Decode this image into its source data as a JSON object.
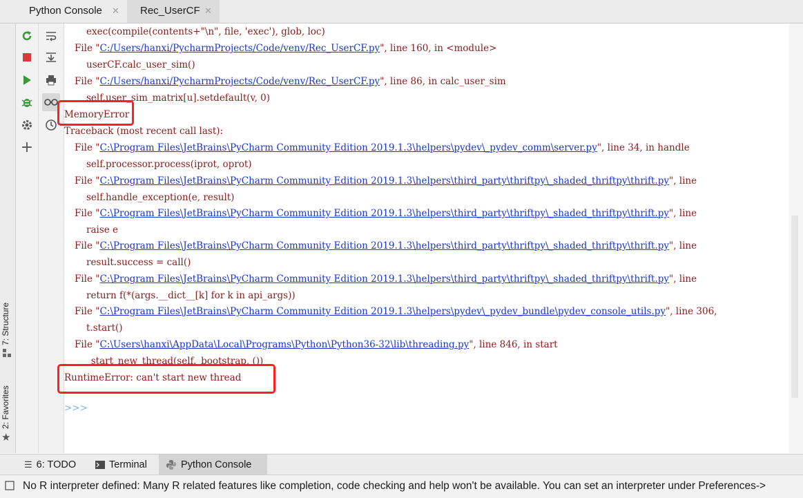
{
  "tabs": [
    {
      "label": "Python Console",
      "active": false
    },
    {
      "label": "Rec_UserCF",
      "active": true
    }
  ],
  "left_strip": {
    "structure_label": "7: Structure",
    "favorites_label": "2: Favorites"
  },
  "toolbar": {
    "icons": [
      "rerun-icon",
      "stop-icon",
      "run-icon",
      "debug-icon",
      "settings-icon",
      "add-icon"
    ],
    "icons2": [
      "soft-wrap-icon",
      "scroll-to-end-icon",
      "print-icon",
      "show-variables-icon",
      "history-icon"
    ]
  },
  "console": {
    "lines": [
      {
        "indent": 2,
        "parts": [
          {
            "t": "exec(compile(contents+\"\\n\", file, 'exec'), glob, loc)",
            "c": "err"
          }
        ]
      },
      {
        "indent": 1,
        "parts": [
          {
            "t": "File \"",
            "c": "err"
          },
          {
            "t": "C:/Users/hanxi/PycharmProjects/Code/venv/Rec_UserCF.py",
            "c": "link"
          },
          {
            "t": "\", line 160, in <module>",
            "c": "err"
          }
        ]
      },
      {
        "indent": 2,
        "parts": [
          {
            "t": "userCF.calc_user_sim()",
            "c": "err"
          }
        ]
      },
      {
        "indent": 1,
        "parts": [
          {
            "t": "File \"",
            "c": "err"
          },
          {
            "t": "C:/Users/hanxi/PycharmProjects/Code/venv/Rec_UserCF.py",
            "c": "link"
          },
          {
            "t": "\", line 86, in calc_user_sim",
            "c": "err"
          }
        ]
      },
      {
        "indent": 2,
        "parts": [
          {
            "t": "self.user_sim_matrix[u].setdefault(v, 0)",
            "c": "err"
          }
        ]
      },
      {
        "indent": 0,
        "parts": [
          {
            "t": "MemoryError",
            "c": "err"
          }
        ]
      },
      {
        "indent": 0,
        "parts": [
          {
            "t": "Traceback (most recent call last):",
            "c": "err"
          }
        ]
      },
      {
        "indent": 1,
        "parts": [
          {
            "t": "File \"",
            "c": "err"
          },
          {
            "t": "C:\\Program Files\\JetBrains\\PyCharm Community Edition 2019.1.3\\helpers\\pydev\\_pydev_comm\\server.py",
            "c": "link"
          },
          {
            "t": "\", line 34, in handle",
            "c": "err"
          }
        ]
      },
      {
        "indent": 2,
        "parts": [
          {
            "t": "self.processor.process(iprot, oprot)",
            "c": "err"
          }
        ]
      },
      {
        "indent": 1,
        "parts": [
          {
            "t": "File \"",
            "c": "err"
          },
          {
            "t": "C:\\Program Files\\JetBrains\\PyCharm Community Edition 2019.1.3\\helpers\\third_party\\thriftpy\\_shaded_thriftpy\\thrift.py",
            "c": "link"
          },
          {
            "t": "\", line",
            "c": "err"
          }
        ]
      },
      {
        "indent": 2,
        "parts": [
          {
            "t": "self.handle_exception(e, result)",
            "c": "err"
          }
        ]
      },
      {
        "indent": 1,
        "parts": [
          {
            "t": "File \"",
            "c": "err"
          },
          {
            "t": "C:\\Program Files\\JetBrains\\PyCharm Community Edition 2019.1.3\\helpers\\third_party\\thriftpy\\_shaded_thriftpy\\thrift.py",
            "c": "link"
          },
          {
            "t": "\", line",
            "c": "err"
          }
        ]
      },
      {
        "indent": 2,
        "parts": [
          {
            "t": "raise e",
            "c": "err"
          }
        ]
      },
      {
        "indent": 1,
        "parts": [
          {
            "t": "File \"",
            "c": "err"
          },
          {
            "t": "C:\\Program Files\\JetBrains\\PyCharm Community Edition 2019.1.3\\helpers\\third_party\\thriftpy\\_shaded_thriftpy\\thrift.py",
            "c": "link"
          },
          {
            "t": "\", line",
            "c": "err"
          }
        ]
      },
      {
        "indent": 2,
        "parts": [
          {
            "t": "result.success = call()",
            "c": "err"
          }
        ]
      },
      {
        "indent": 1,
        "parts": [
          {
            "t": "File \"",
            "c": "err"
          },
          {
            "t": "C:\\Program Files\\JetBrains\\PyCharm Community Edition 2019.1.3\\helpers\\third_party\\thriftpy\\_shaded_thriftpy\\thrift.py",
            "c": "link"
          },
          {
            "t": "\", line",
            "c": "err"
          }
        ]
      },
      {
        "indent": 2,
        "parts": [
          {
            "t": "return f(*(args.__dict__[k] for k in api_args))",
            "c": "err"
          }
        ]
      },
      {
        "indent": 1,
        "parts": [
          {
            "t": "File \"",
            "c": "err"
          },
          {
            "t": "C:\\Program Files\\JetBrains\\PyCharm Community Edition 2019.1.3\\helpers\\pydev\\_pydev_bundle\\pydev_console_utils.py",
            "c": "link"
          },
          {
            "t": "\", line 306,",
            "c": "err"
          }
        ]
      },
      {
        "indent": 2,
        "parts": [
          {
            "t": "t.start()",
            "c": "err"
          }
        ]
      },
      {
        "indent": 1,
        "parts": [
          {
            "t": "File \"",
            "c": "err"
          },
          {
            "t": "C:\\Users\\hanxi\\AppData\\Local\\Programs\\Python\\Python36-32\\lib\\threading.py",
            "c": "link"
          },
          {
            "t": "\", line 846, in start",
            "c": "err"
          }
        ]
      },
      {
        "indent": 2,
        "parts": [
          {
            "t": "_start_new_thread(self._bootstrap, ())",
            "c": "err"
          }
        ]
      },
      {
        "indent": 0,
        "parts": [
          {
            "t": "RuntimeError: can't start new thread",
            "c": "err"
          }
        ]
      },
      {
        "indent": 0,
        "parts": [
          {
            "t": "",
            "c": "err"
          }
        ]
      },
      {
        "indent": 0,
        "parts": [
          {
            "t": ">>>",
            "c": "prompt"
          }
        ]
      }
    ]
  },
  "bottom_tabs": [
    {
      "label": "6: TODO",
      "icon": "todo-list-icon",
      "active": false
    },
    {
      "label": "Terminal",
      "icon": "terminal-icon",
      "active": false
    },
    {
      "label": "Python Console",
      "icon": "python-console-icon",
      "active": true
    }
  ],
  "status": {
    "text": "No R interpreter defined: Many R related features like completion, code checking and help won't be available. You can set an interpreter under Preferences->"
  },
  "colors": {
    "error_text": "#8b1a1a",
    "link_text": "#1a35c9",
    "highlight_box": "#ff2020",
    "prompt": "#7ab3e3"
  }
}
